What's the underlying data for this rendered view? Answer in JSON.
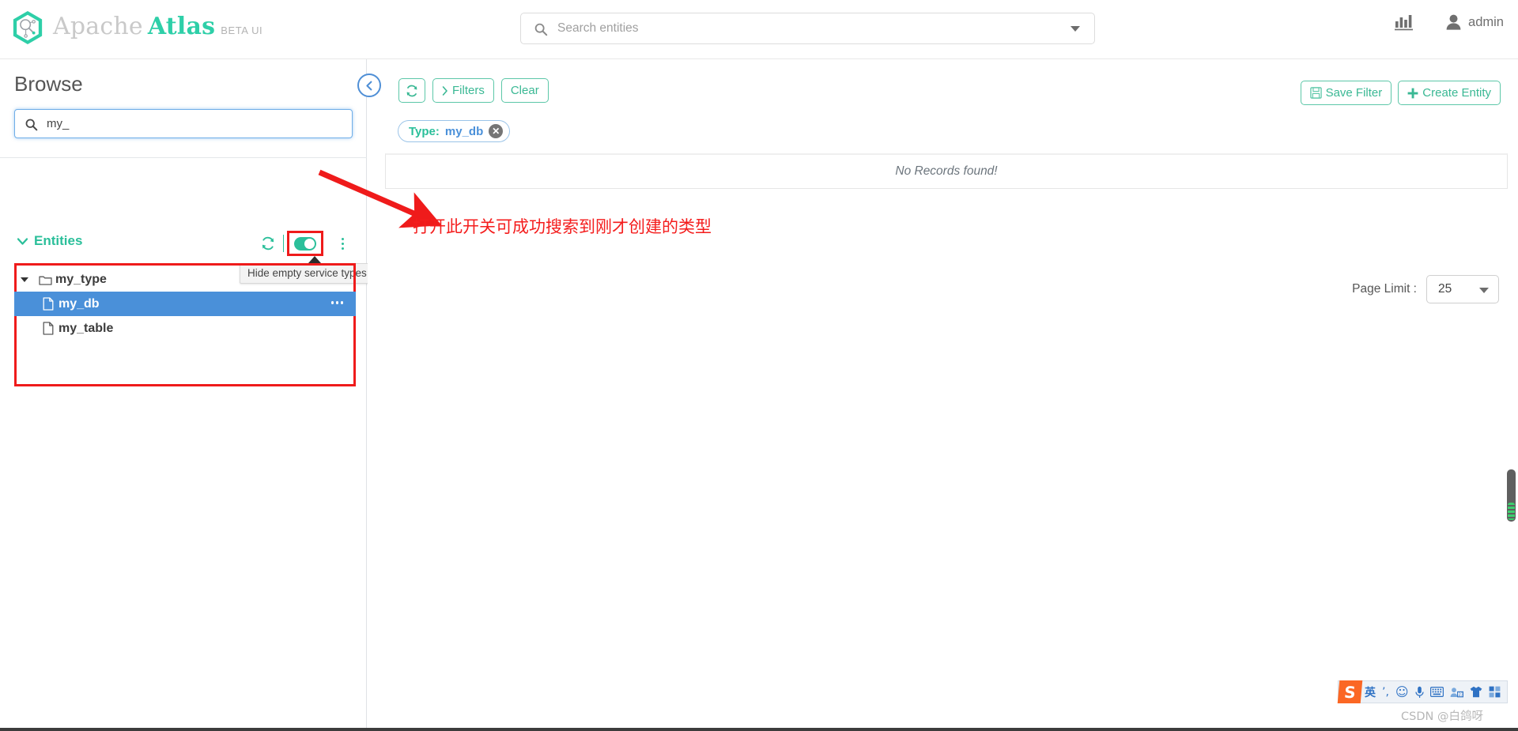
{
  "header": {
    "brand_apache": "Apache",
    "brand_atlas": "Atlas",
    "brand_beta": "BETA UI",
    "logo_icon": "atlas-hexagon-logo",
    "search": {
      "icon": "search-icon",
      "placeholder": "Search entities",
      "value": "",
      "caret_icon": "chevron-down-icon"
    },
    "stats_icon": "bar-chart-statistics-icon",
    "user_icon": "user-icon",
    "user_name": "admin"
  },
  "sidebar": {
    "title": "Browse",
    "search": {
      "icon": "search-icon",
      "value": "my_",
      "placeholder": ""
    },
    "section": {
      "label": "Entities",
      "chevron_icon": "chevron-down-icon",
      "refresh_icon": "refresh-icon",
      "toggle_icon": "toggle-switch-on",
      "kebab_icon": "vertical-ellipsis-icon"
    },
    "tooltip": "Hide empty service types",
    "tree": [
      {
        "label": "my_type",
        "icon": "folder-icon",
        "level": 0,
        "expanded": true,
        "selected": false
      },
      {
        "label": "my_db",
        "icon": "file-icon",
        "level": 1,
        "expanded": false,
        "selected": true
      },
      {
        "label": "my_table",
        "icon": "file-icon",
        "level": 1,
        "expanded": false,
        "selected": false
      }
    ],
    "collapse_button_icon": "chevron-left-icon"
  },
  "main": {
    "toolbar": {
      "refresh_icon": "refresh-icon",
      "filters_label": "Filters",
      "filters_icon": "chevron-right-icon",
      "clear_label": "Clear",
      "save_filter_label": "Save Filter",
      "save_filter_icon": "floppy-save-icon",
      "create_entity_label": "Create Entity",
      "create_entity_icon": "plus-icon"
    },
    "chip": {
      "key": "Type:",
      "value": "my_db",
      "remove_icon": "close-circle-icon"
    },
    "records": {
      "empty_message": "No Records found!"
    },
    "page_limit": {
      "label": "Page Limit :",
      "value": "25",
      "caret_icon": "chevron-down-icon"
    }
  },
  "annotation": {
    "text": "打开此开关可成功搜索到刚才创建的类型",
    "arrow_icon": "red-arrow-icon",
    "color": "#f41d1d"
  },
  "ime": {
    "logo": "S",
    "items": [
      "英",
      "’,",
      "☺",
      "\u0001",
      "⌨",
      "\u0002",
      "\u0003",
      "\u0004"
    ],
    "item_names": [
      "chinese-english-toggle",
      "punctuation-icon",
      "emoji-icon",
      "voice-input-icon",
      "soft-keyboard-icon",
      "user-dict-icon",
      "skin-icon",
      "toolbox-icon"
    ]
  },
  "watermark": "CSDN @白鸽呀",
  "colors": {
    "accent_green": "#2bbf9a",
    "selection_blue": "#4a90d9",
    "annotation_red": "#ef1b1b"
  }
}
